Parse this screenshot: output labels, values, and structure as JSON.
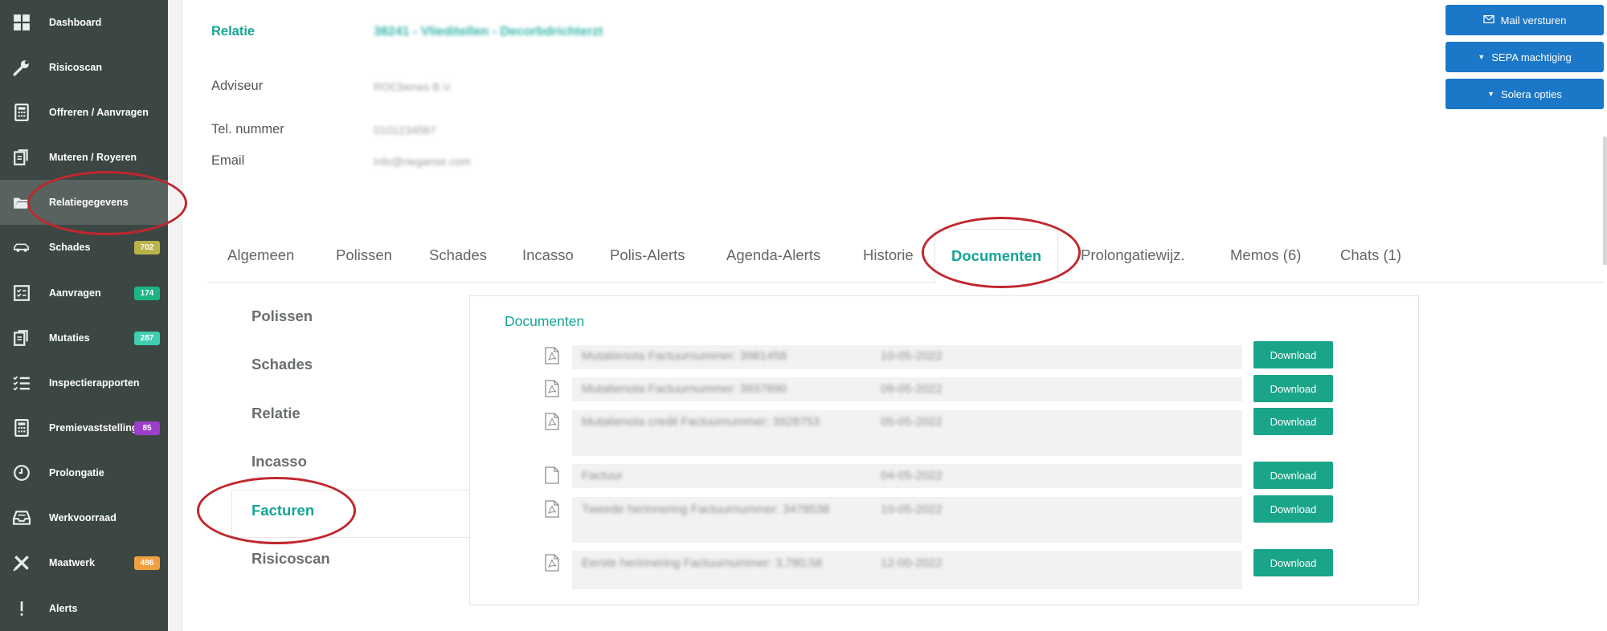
{
  "sidebar": {
    "items": [
      {
        "label": "Dashboard",
        "icon": "dashboard-grid-icon"
      },
      {
        "label": "Risicoscan",
        "icon": "wrench-icon"
      },
      {
        "label": "Offreren / Aanvragen",
        "icon": "calculator-icon"
      },
      {
        "label": "Muteren / Royeren",
        "icon": "documents-edit-icon"
      },
      {
        "label": "Relatiegegevens",
        "icon": "folder-open-icon"
      },
      {
        "label": "Schades",
        "icon": "car-icon",
        "badge": "702"
      },
      {
        "label": "Aanvragen",
        "icon": "checklist-icon",
        "badge": "174"
      },
      {
        "label": "Mutaties",
        "icon": "documents-edit-icon",
        "badge": "287"
      },
      {
        "label": "Inspectierapporten",
        "icon": "list-check-icon"
      },
      {
        "label": "Premievaststelling",
        "icon": "calculator-icon",
        "badge": "85"
      },
      {
        "label": "Prolongatie",
        "icon": "clock-icon"
      },
      {
        "label": "Werkvoorraad",
        "icon": "inbox-tray-icon"
      },
      {
        "label": "Maatwerk",
        "icon": "pencil-ruler-icon",
        "badge": "486"
      },
      {
        "label": "Alerts",
        "icon": "exclamation-icon"
      }
    ],
    "badge_colors": {
      "Schades": "#b9b34a",
      "Aanvragen": "#1db384",
      "Mutaties": "#3fcfb0",
      "Premievaststelling": "#9b3fc8",
      "Maatwerk": "#f0a040"
    }
  },
  "relation": {
    "relatie_label": "Relatie",
    "relatie_value": "38241 - Vlieditellen - Decorbdrichterzt",
    "adviseur_label": "Adviseur",
    "adviseur_value": "ROCbenes B.V.",
    "tel_label": "Tel. nummer",
    "tel_value": "0101234567",
    "email_label": "Email",
    "email_value": "info@rieganse.com"
  },
  "actions": {
    "mail": "Mail versturen",
    "sepa": "SEPA machtiging",
    "solera": "Solera opties"
  },
  "tabs": [
    "Algemeen",
    "Polissen",
    "Schades",
    "Incasso",
    "Polis-Alerts",
    "Agenda-Alerts",
    "Historie",
    "Documenten",
    "Prolongatiewijz.",
    "Memos (6)",
    "Chats (1)"
  ],
  "active_tab": "Documenten",
  "subnav": [
    "Polissen",
    "Schades",
    "Relatie",
    "Incasso",
    "Facturen",
    "Risicoscan"
  ],
  "active_subnav": "Facturen",
  "documents": {
    "title": "Documenten",
    "download_label": "Download",
    "rows": [
      {
        "name": "Mutatienota Factuurnummer: 3981458",
        "date": "10-05-2022",
        "icon": "pdf-file-icon"
      },
      {
        "name": "Mutatienota Factuurnummer: 3937690",
        "date": "09-05-2022",
        "icon": "pdf-file-icon"
      },
      {
        "name": "Mutatienota credit Factuurnummer: 3928753",
        "date": "05-05-2022",
        "icon": "pdf-file-icon"
      },
      {
        "name": "Factuur",
        "date": "04-05-2022",
        "icon": "file-icon"
      },
      {
        "name": "Tweede herinnering Factuurnummer: 3478538",
        "date": "10-05-2022",
        "icon": "pdf-file-icon"
      },
      {
        "name": "Eerste herinnering Factuurnummer: 3,780,58",
        "date": "12-00-2022",
        "icon": "pdf-file-icon"
      }
    ]
  },
  "colors": {
    "accent": "#16a596",
    "button_blue": "#1b77c8",
    "download_green": "#1aa589",
    "sidebar": "#3c4744",
    "annotation_red": "#c0272d"
  }
}
